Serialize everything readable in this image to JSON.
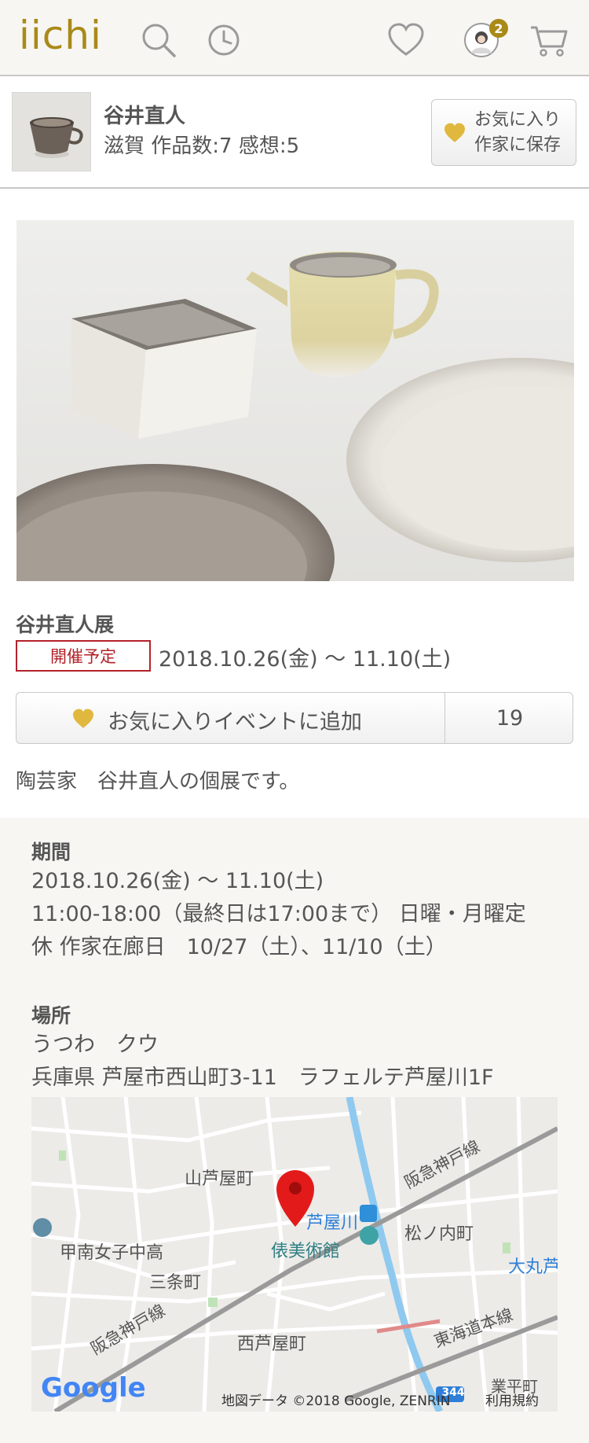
{
  "header": {
    "logo": "iichi",
    "cart_badge": "2",
    "colors": {
      "brand": "#a98a17",
      "alert": "#b3222a"
    },
    "icons": [
      "search-icon",
      "history-icon",
      "heart-icon",
      "avatar",
      "cart-icon"
    ]
  },
  "artist": {
    "name": "谷井直人",
    "meta": "滋賀 作品数:7 感想:5",
    "fav_button": {
      "line1": "お気に入り",
      "line2": "作家に保存"
    }
  },
  "event": {
    "title": "谷井直人展",
    "status": "開催予定",
    "date": "2018.10.26(金) 〜 11.10(土)",
    "fav_button": {
      "label": "お気に入りイベントに追加",
      "count": "19"
    },
    "description": "陶芸家　谷井直人の個展です。"
  },
  "details": {
    "period_heading": "期間",
    "period_lines": [
      "2018.10.26(金) 〜 11.10(土)",
      "11:00-18:00（最終日は17:00まで） 日曜・月曜定",
      "休 作家在廊日　10/27（土）、11/10（土）"
    ],
    "place_heading": "場所",
    "place_lines": [
      "うつわ　クウ",
      "兵庫県 芦屋市西山町3-11　ラフェルテ芦屋川1F"
    ]
  },
  "map": {
    "labels": {
      "yamaashiya": "山芦屋町",
      "hankyu1": "阪急神戸線",
      "ashiyagawa": "芦屋川",
      "matsunouchi": "松ノ内町",
      "konan": "甲南女子中高",
      "museum": "俵美術館",
      "sanjo": "三条町",
      "daimaru": "大丸芦",
      "hankyu2": "阪急神戸線",
      "nishiashiya": "西芦屋町",
      "tokaido": "東海道本線",
      "route": "344",
      "narihira": "業平町"
    },
    "google": "Google",
    "attribution": "地図データ ©2018 Google, ZENRIN",
    "terms": "利用規約"
  }
}
